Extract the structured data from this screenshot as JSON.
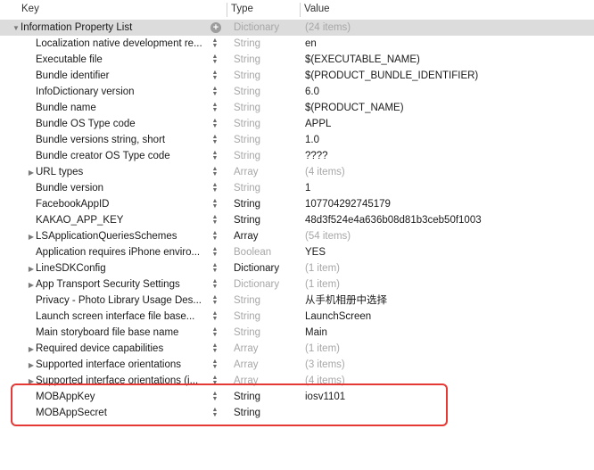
{
  "header": {
    "key": "Key",
    "type": "Type",
    "value": "Value"
  },
  "rows": [
    {
      "level": 0,
      "disclosure": "open",
      "key": "Information Property List",
      "type": "Dictionary",
      "type_muted": true,
      "value": "(24 items)",
      "value_muted": true,
      "control": "add",
      "selected": true
    },
    {
      "level": 1,
      "disclosure": "none",
      "key": "Localization native development re...",
      "type": "String",
      "type_muted": true,
      "value": "en",
      "value_muted": false,
      "control": "stepper"
    },
    {
      "level": 1,
      "disclosure": "none",
      "key": "Executable file",
      "type": "String",
      "type_muted": true,
      "value": "$(EXECUTABLE_NAME)",
      "value_muted": false,
      "control": "stepper"
    },
    {
      "level": 1,
      "disclosure": "none",
      "key": "Bundle identifier",
      "type": "String",
      "type_muted": true,
      "value": "$(PRODUCT_BUNDLE_IDENTIFIER)",
      "value_muted": false,
      "control": "stepper"
    },
    {
      "level": 1,
      "disclosure": "none",
      "key": "InfoDictionary version",
      "type": "String",
      "type_muted": true,
      "value": "6.0",
      "value_muted": false,
      "control": "stepper"
    },
    {
      "level": 1,
      "disclosure": "none",
      "key": "Bundle name",
      "type": "String",
      "type_muted": true,
      "value": "$(PRODUCT_NAME)",
      "value_muted": false,
      "control": "stepper"
    },
    {
      "level": 1,
      "disclosure": "none",
      "key": "Bundle OS Type code",
      "type": "String",
      "type_muted": true,
      "value": "APPL",
      "value_muted": false,
      "control": "stepper"
    },
    {
      "level": 1,
      "disclosure": "none",
      "key": "Bundle versions string, short",
      "type": "String",
      "type_muted": true,
      "value": "1.0",
      "value_muted": false,
      "control": "stepper"
    },
    {
      "level": 1,
      "disclosure": "none",
      "key": "Bundle creator OS Type code",
      "type": "String",
      "type_muted": true,
      "value": "????",
      "value_muted": false,
      "control": "stepper"
    },
    {
      "level": 1,
      "disclosure": "closed",
      "key": "URL types",
      "type": "Array",
      "type_muted": true,
      "value": "(4 items)",
      "value_muted": true,
      "control": "stepper"
    },
    {
      "level": 1,
      "disclosure": "none",
      "key": "Bundle version",
      "type": "String",
      "type_muted": true,
      "value": "1",
      "value_muted": false,
      "control": "stepper"
    },
    {
      "level": 1,
      "disclosure": "none",
      "key": "FacebookAppID",
      "type": "String",
      "type_muted": false,
      "value": "107704292745179",
      "value_muted": false,
      "control": "stepper"
    },
    {
      "level": 1,
      "disclosure": "none",
      "key": "KAKAO_APP_KEY",
      "type": "String",
      "type_muted": false,
      "value": "48d3f524e4a636b08d81b3ceb50f1003",
      "value_muted": false,
      "control": "stepper"
    },
    {
      "level": 1,
      "disclosure": "closed",
      "key": "LSApplicationQueriesSchemes",
      "type": "Array",
      "type_muted": false,
      "value": "(54 items)",
      "value_muted": true,
      "control": "stepper"
    },
    {
      "level": 1,
      "disclosure": "none",
      "key": "Application requires iPhone enviro...",
      "type": "Boolean",
      "type_muted": true,
      "value": "YES",
      "value_muted": false,
      "control": "stepper"
    },
    {
      "level": 1,
      "disclosure": "closed",
      "key": "LineSDKConfig",
      "type": "Dictionary",
      "type_muted": false,
      "value": "(1 item)",
      "value_muted": true,
      "control": "stepper"
    },
    {
      "level": 1,
      "disclosure": "closed",
      "key": "App Transport Security Settings",
      "type": "Dictionary",
      "type_muted": true,
      "value": "(1 item)",
      "value_muted": true,
      "control": "stepper"
    },
    {
      "level": 1,
      "disclosure": "none",
      "key": "Privacy - Photo Library Usage Des...",
      "type": "String",
      "type_muted": true,
      "value": "从手机相册中选择",
      "value_muted": false,
      "control": "stepper"
    },
    {
      "level": 1,
      "disclosure": "none",
      "key": "Launch screen interface file base...",
      "type": "String",
      "type_muted": true,
      "value": "LaunchScreen",
      "value_muted": false,
      "control": "stepper"
    },
    {
      "level": 1,
      "disclosure": "none",
      "key": "Main storyboard file base name",
      "type": "String",
      "type_muted": true,
      "value": "Main",
      "value_muted": false,
      "control": "stepper"
    },
    {
      "level": 1,
      "disclosure": "closed",
      "key": "Required device capabilities",
      "type": "Array",
      "type_muted": true,
      "value": "(1 item)",
      "value_muted": true,
      "control": "stepper"
    },
    {
      "level": 1,
      "disclosure": "closed",
      "key": "Supported interface orientations",
      "type": "Array",
      "type_muted": true,
      "value": "(3 items)",
      "value_muted": true,
      "control": "stepper"
    },
    {
      "level": 1,
      "disclosure": "closed",
      "key": "Supported interface orientations (i...",
      "type": "Array",
      "type_muted": true,
      "value": "(4 items)",
      "value_muted": true,
      "control": "stepper"
    },
    {
      "level": 1,
      "disclosure": "none",
      "key": "MOBAppKey",
      "type": "String",
      "type_muted": false,
      "value": "iosv1101",
      "value_muted": false,
      "control": "stepper"
    },
    {
      "level": 1,
      "disclosure": "none",
      "key": "MOBAppSecret",
      "type": "String",
      "type_muted": false,
      "value": "",
      "value_muted": false,
      "control": "stepper"
    }
  ],
  "colors": {
    "highlight_border": "#e53935",
    "muted_text": "#a7a7a7",
    "selected_row": "#dcdcdc"
  },
  "icons": {
    "open": "disclosure-open-icon",
    "closed": "disclosure-closed-icon",
    "stepper": "stepper-icon",
    "add": "add-icon"
  }
}
